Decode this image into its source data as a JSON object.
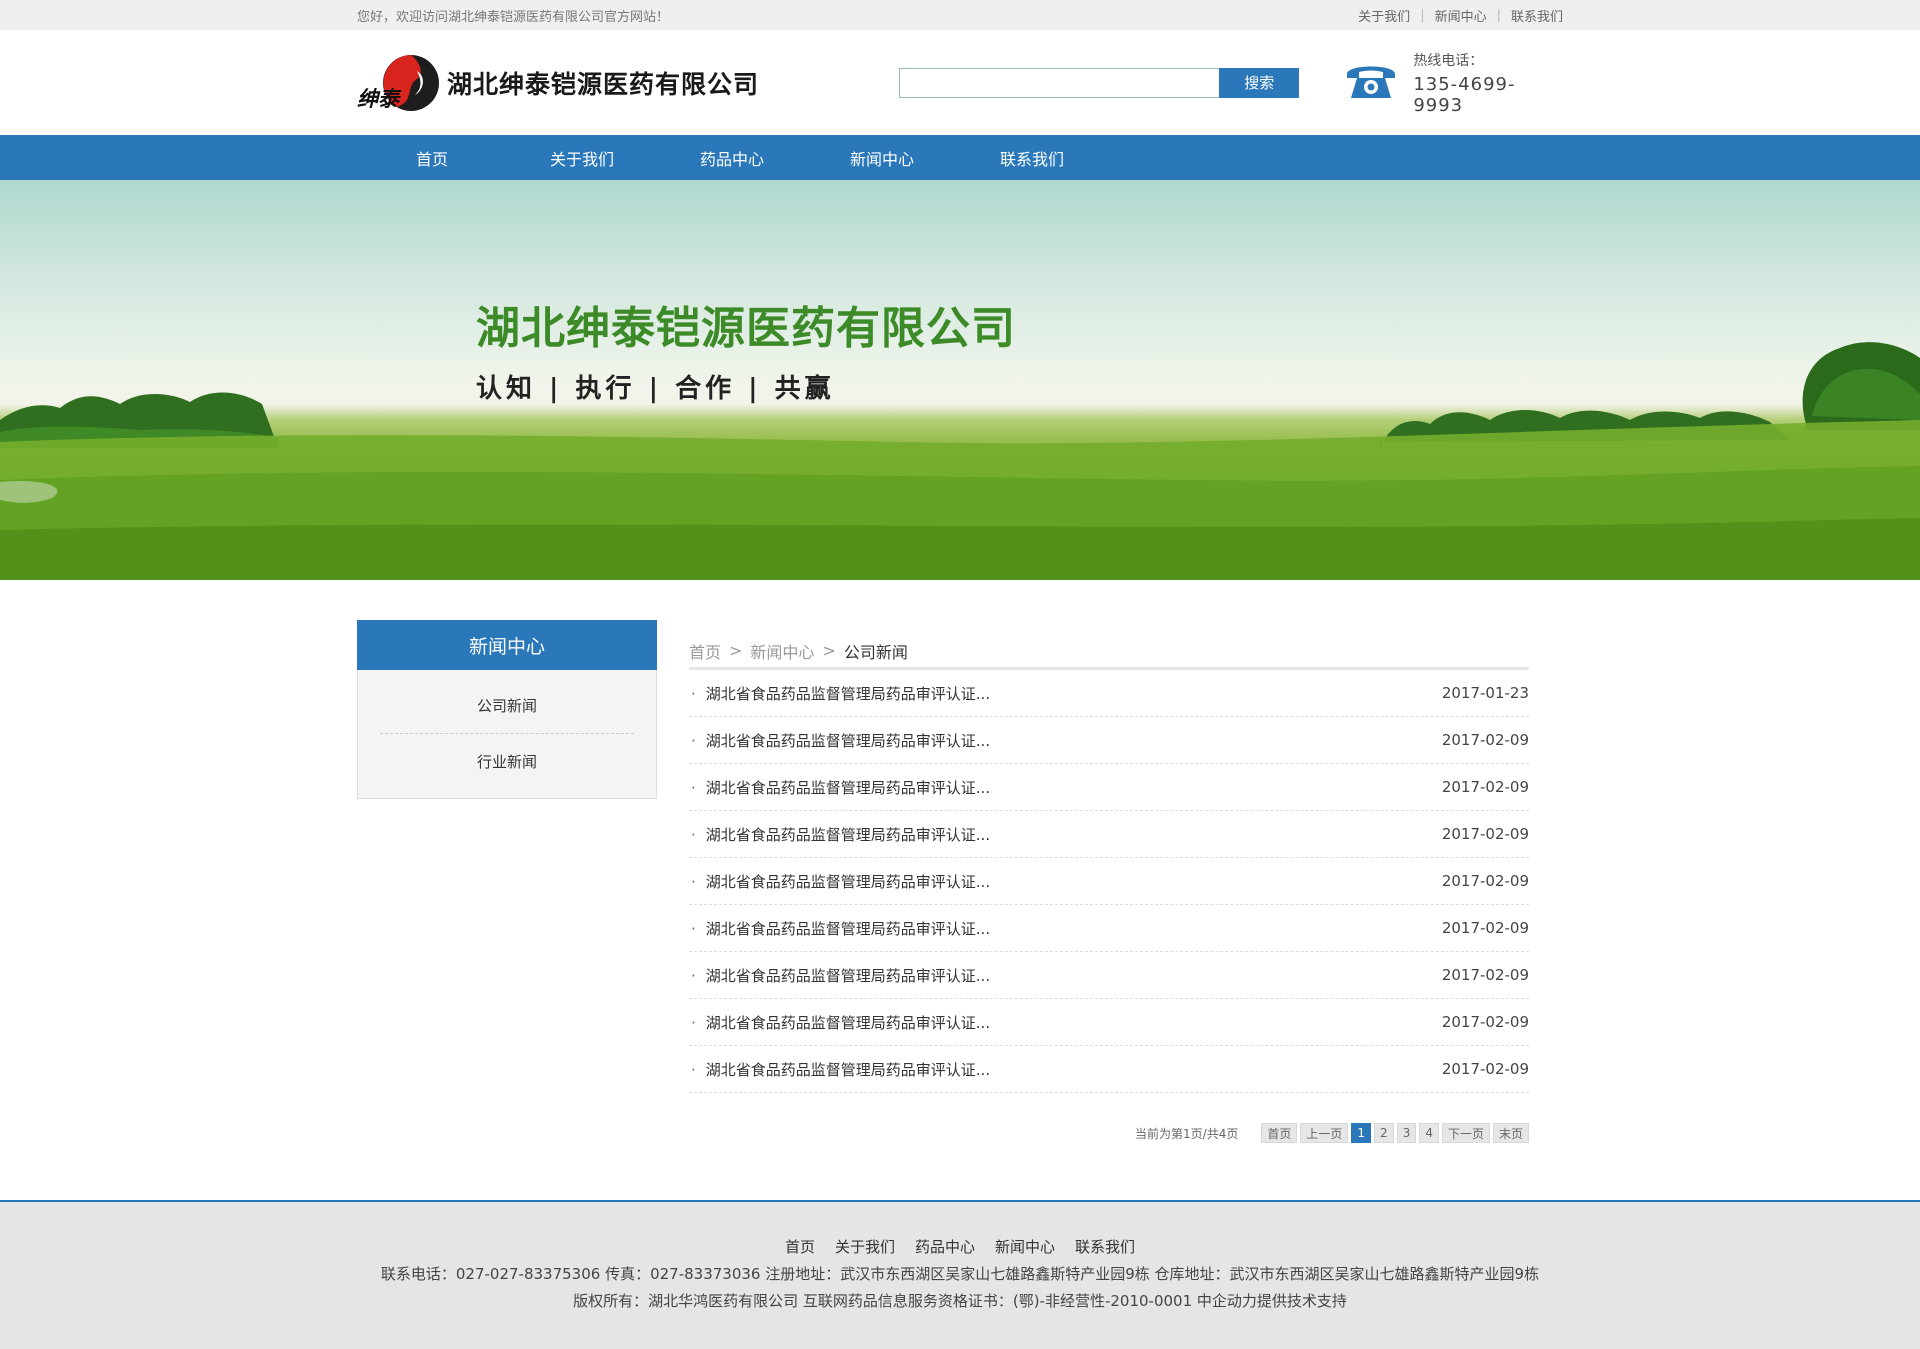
{
  "topbar": {
    "welcome": "您好，欢迎访问湖北绅泰铠源医药有限公司官方网站！",
    "links": [
      "关于我们",
      "新闻中心",
      "联系我们"
    ],
    "separator": "|"
  },
  "header": {
    "logo_text": "湖北绅泰铠源医药有限公司",
    "logo_mark_text": "绅泰",
    "search_placeholder": "",
    "search_button": "搜索",
    "hotline_label": "热线电话：",
    "hotline_number": "135-4699-9993"
  },
  "nav": [
    "首页",
    "关于我们",
    "药品中心",
    "新闻中心",
    "联系我们"
  ],
  "banner": {
    "title": "湖北绅泰铠源医药有限公司",
    "slogan": "认知 | 执行 | 合作 | 共赢"
  },
  "sidebar": {
    "title": "新闻中心",
    "items": [
      "公司新闻",
      "行业新闻"
    ]
  },
  "breadcrumb": {
    "items": [
      "首页",
      "新闻中心",
      "公司新闻"
    ],
    "separator": ">"
  },
  "news": [
    {
      "title": "湖北省食品药品监督管理局药品审评认证...",
      "date": "2017-01-23"
    },
    {
      "title": "湖北省食品药品监督管理局药品审评认证...",
      "date": "2017-02-09"
    },
    {
      "title": "湖北省食品药品监督管理局药品审评认证...",
      "date": "2017-02-09"
    },
    {
      "title": "湖北省食品药品监督管理局药品审评认证...",
      "date": "2017-02-09"
    },
    {
      "title": "湖北省食品药品监督管理局药品审评认证...",
      "date": "2017-02-09"
    },
    {
      "title": "湖北省食品药品监督管理局药品审评认证...",
      "date": "2017-02-09"
    },
    {
      "title": "湖北省食品药品监督管理局药品审评认证...",
      "date": "2017-02-09"
    },
    {
      "title": "湖北省食品药品监督管理局药品审评认证...",
      "date": "2017-02-09"
    },
    {
      "title": "湖北省食品药品监督管理局药品审评认证...",
      "date": "2017-02-09"
    }
  ],
  "pagination": {
    "info": "当前为第1页/共4页",
    "first": "首页",
    "prev": "上一页",
    "pages": [
      "1",
      "2",
      "3",
      "4"
    ],
    "current": "1",
    "next": "下一页",
    "last": "末页"
  },
  "footer": {
    "links": [
      "首页",
      "关于我们",
      "药品中心",
      "新闻中心",
      "联系我们"
    ],
    "contact": "联系电话：027-027-83375306 传真：027-83373036 注册地址：武汉市东西湖区吴家山七雄路鑫斯特产业园9栋 仓库地址：武汉市东西湖区吴家山七雄路鑫斯特产业园9栋",
    "copyright": "版权所有：湖北华鸿医药有限公司 互联网药品信息服务资格证书：(鄂)-非经营性-2010-0001 中企动力提供技术支持"
  },
  "colors": {
    "primary": "#2a78ba",
    "footer_bg": "#e5e5e5",
    "banner_title": "#3d8a28"
  }
}
